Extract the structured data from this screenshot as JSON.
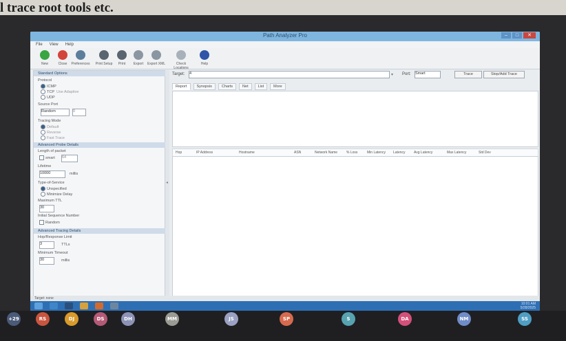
{
  "caption": "l trace root tools etc.",
  "window": {
    "title": "Path Analyzer Pro",
    "menu": [
      "File",
      "View",
      "Help"
    ]
  },
  "toolbar": {
    "items": [
      {
        "label": "New",
        "icon": "new-icon",
        "color": "#3aa543"
      },
      {
        "label": "Close",
        "icon": "close-icon",
        "color": "#d3443a"
      },
      {
        "label": "Preferences",
        "icon": "preferences-icon",
        "color": "#5d7e9b"
      },
      {
        "label": "Print Setup",
        "icon": "print-setup-icon",
        "color": "#5a6570"
      },
      {
        "label": "Print",
        "icon": "print-icon",
        "color": "#5a6570"
      },
      {
        "label": "Export",
        "icon": "export-icon",
        "color": "#8a96a2"
      },
      {
        "label": "Export XML",
        "icon": "export-xml-icon",
        "color": "#8a96a2"
      },
      {
        "label": "Check Locations",
        "icon": "check-icon",
        "color": "#a8b1ba"
      },
      {
        "label": "Help",
        "icon": "help-icon",
        "color": "#2f54a8"
      }
    ]
  },
  "left_panel": {
    "standard_options": "Standard Options",
    "protocol_label": "Protocol",
    "protocols": [
      "ICMP",
      "TCP",
      "UDP"
    ],
    "tcp_note": "Use Adaptive",
    "source_port_label": "Source Port",
    "source_port_value": "Random",
    "source_port_num": "0",
    "tracing_mode_label": "Tracing Mode",
    "tracing_modes": [
      "Default",
      "Reverse",
      "Fast Trace"
    ],
    "advanced_probe": "Advanced Probe Details",
    "length_label": "Length of packet",
    "length_check": "smart",
    "length_value": "64",
    "lifetime_label": "Lifetime",
    "lifetime_value": "10000",
    "lifetime_unit": "millis",
    "type_of_service_label": "Type-of-Service",
    "tos_options": [
      "Unspecified",
      "Minimize Delay"
    ],
    "max_ttl_label": "Maximum TTL",
    "max_ttl_value": "30",
    "initial_seq_label": "Initial Sequence Number",
    "initial_seq_check": "Random",
    "advanced_tracing": "Advanced Tracing Details",
    "hops_label": "Hop/Response Limit",
    "hops_value": "3",
    "hops_unit": "TTLs",
    "timeout_label": "Minimum Timeout",
    "timeout_value": "30",
    "timeout_unit": "millis"
  },
  "target": {
    "label": "Target:",
    "value": "4",
    "port_label": "Port:",
    "port_value": "Smart",
    "trace_button": "Trace",
    "stop_button": "Stop/Add Trace"
  },
  "tabs": [
    "Report",
    "Synopsis",
    "Charts",
    "Net",
    "List",
    "More"
  ],
  "columns": [
    "Hop",
    "IP Address",
    "Hostname",
    "ASN",
    "Network Name",
    "% Loss",
    "Min Latency",
    "Latency",
    "Avg Latency",
    "Max Latency",
    "Std Dev"
  ],
  "status": {
    "text": "Target: none"
  },
  "taskbar_clock": [
    "10:01 AM",
    "5/28/2025"
  ],
  "participants": [
    {
      "initials": "+29",
      "color": "#4a5a78"
    },
    {
      "initials": "RS",
      "color": "#c9553f"
    },
    {
      "initials": "DJ",
      "color": "#d99a2b"
    },
    {
      "initials": "DS",
      "color": "#b55a76"
    },
    {
      "initials": "DH",
      "color": "#8c93b6"
    },
    {
      "initials": "MM",
      "color": "#9a9c94"
    },
    {
      "initials": "JS",
      "color": "#9aa1c2"
    },
    {
      "initials": "SP",
      "color": "#d66a4e"
    },
    {
      "initials": "S",
      "color": "#57a3b0"
    },
    {
      "initials": "DA",
      "color": "#d4507a"
    },
    {
      "initials": "NM",
      "color": "#6f8cc7"
    },
    {
      "initials": "SS",
      "color": "#4f9ec4"
    }
  ]
}
